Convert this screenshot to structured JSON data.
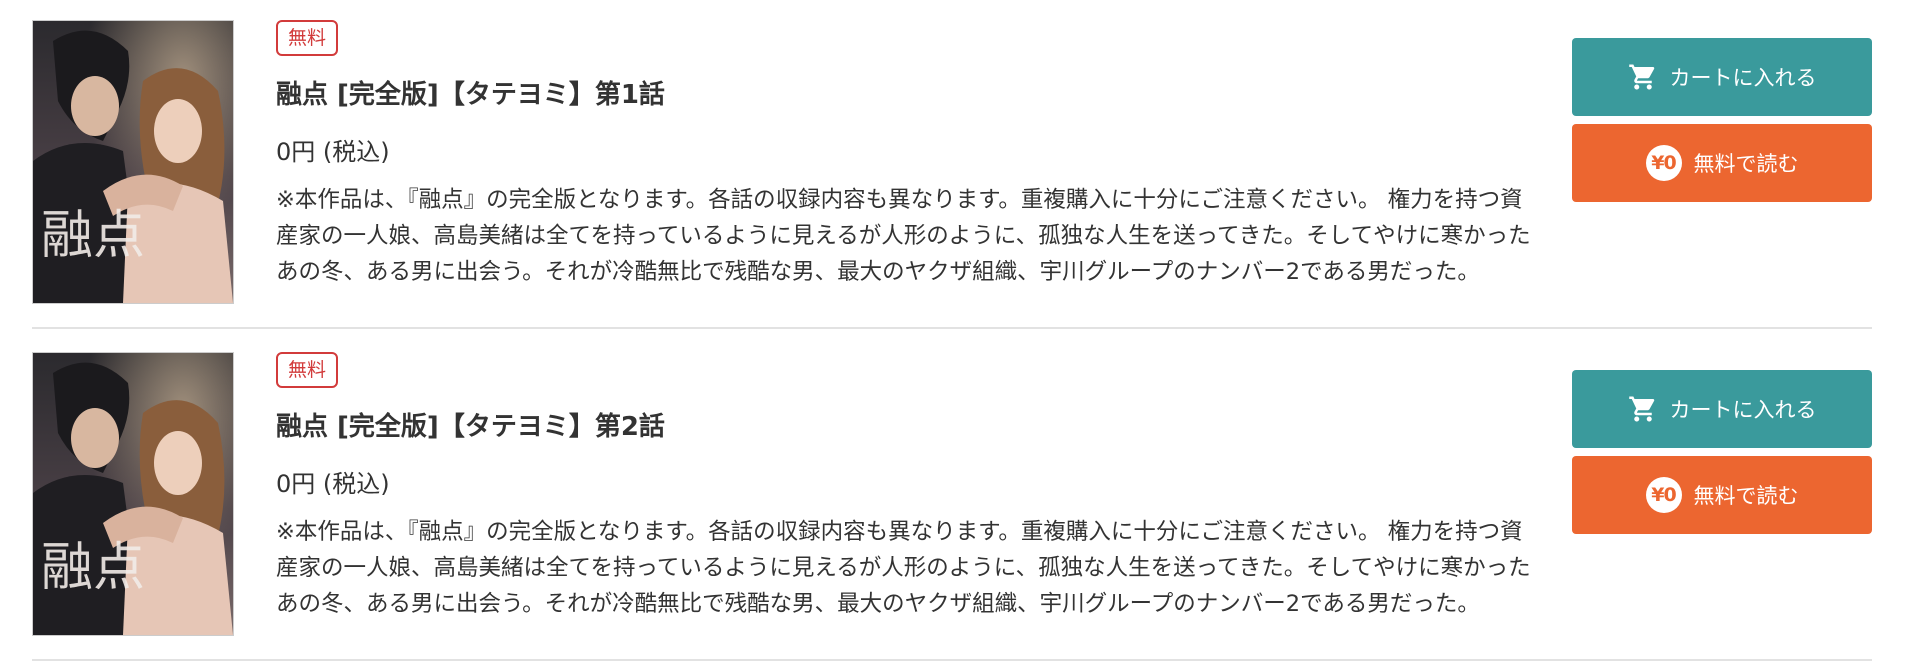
{
  "items": [
    {
      "badge": "無料",
      "title": "融点 [完全版]【タテヨミ】第1話",
      "price": "0円 (税込)",
      "description": "※本作品は、『融点』の完全版となります。各話の収録内容も異なります。重複購入に十分にご注意ください。 権力を持つ資産家の一人娘、高島美緒は全てを持っているように見えるが人形のように、孤独な人生を送ってきた。そしてやけに寒かったあの冬、ある男に出会う。それが冷酷無比で残酷な男、最大のヤクザ組織、宇川グループのナンバー2である男だった。",
      "cart_label": "カートに入れる",
      "free_read_label": "無料で読む",
      "free_read_icon_text": "¥0",
      "cover_title": "融点"
    },
    {
      "badge": "無料",
      "title": "融点 [完全版]【タテヨミ】第2話",
      "price": "0円 (税込)",
      "description": "※本作品は、『融点』の完全版となります。各話の収録内容も異なります。重複購入に十分にご注意ください。 権力を持つ資産家の一人娘、高島美緒は全てを持っているように見えるが人形のように、孤独な人生を送ってきた。そしてやけに寒かったあの冬、ある男に出会う。それが冷酷無比で残酷な男、最大のヤクザ組織、宇川グループのナンバー2である男だった。",
      "cart_label": "カートに入れる",
      "free_read_label": "無料で読む",
      "free_read_icon_text": "¥0",
      "cover_title": "融点"
    }
  ],
  "icons": {
    "cart": "cart-icon",
    "free": "yen-zero-icon"
  },
  "colors": {
    "cart_button": "#3a9a9c",
    "free_button": "#ec6630",
    "badge": "#d23b3b",
    "divider": "#e2e2e2"
  }
}
